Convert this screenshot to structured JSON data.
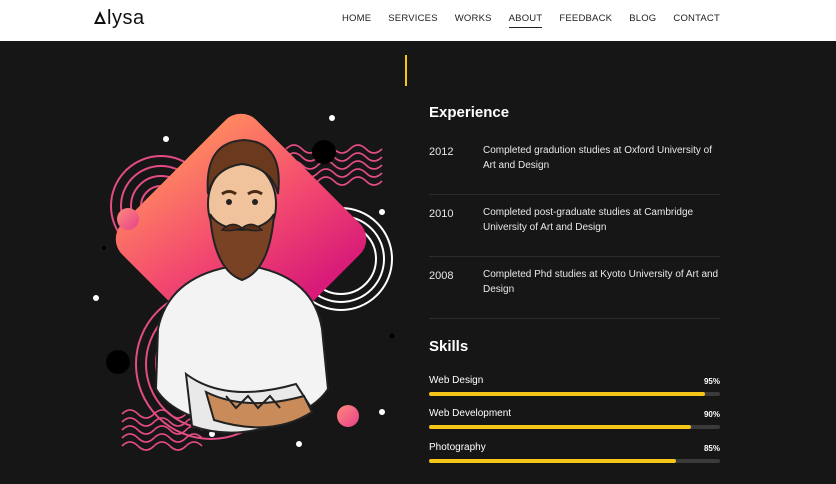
{
  "header": {
    "logo": "lysa",
    "nav": [
      "HOME",
      "SERVICES",
      "WORKS",
      "ABOUT",
      "FEEDBACK",
      "BLOG",
      "CONTACT"
    ],
    "active_nav": "ABOUT"
  },
  "experience": {
    "title": "Experience",
    "items": [
      {
        "year": "2012",
        "text": "Completed gradution studies at Oxford University of Art and Design"
      },
      {
        "year": "2010",
        "text": "Completed post-graduate studies at Cambridge University of Art and Design"
      },
      {
        "year": "2008",
        "text": "Completed Phd studies at Kyoto University of Art and Design"
      }
    ]
  },
  "skills": {
    "title": "Skills",
    "items": [
      {
        "label": "Web Design",
        "percent": "95%",
        "level": 0.95
      },
      {
        "label": "Web Development",
        "percent": "90%",
        "level": 0.9
      },
      {
        "label": "Photography",
        "percent": "85%",
        "level": 0.85
      }
    ]
  },
  "colors": {
    "accent": "#f5c518",
    "diamond_start": "#ff7a5c",
    "diamond_end": "#e0207a",
    "background": "#161616"
  }
}
